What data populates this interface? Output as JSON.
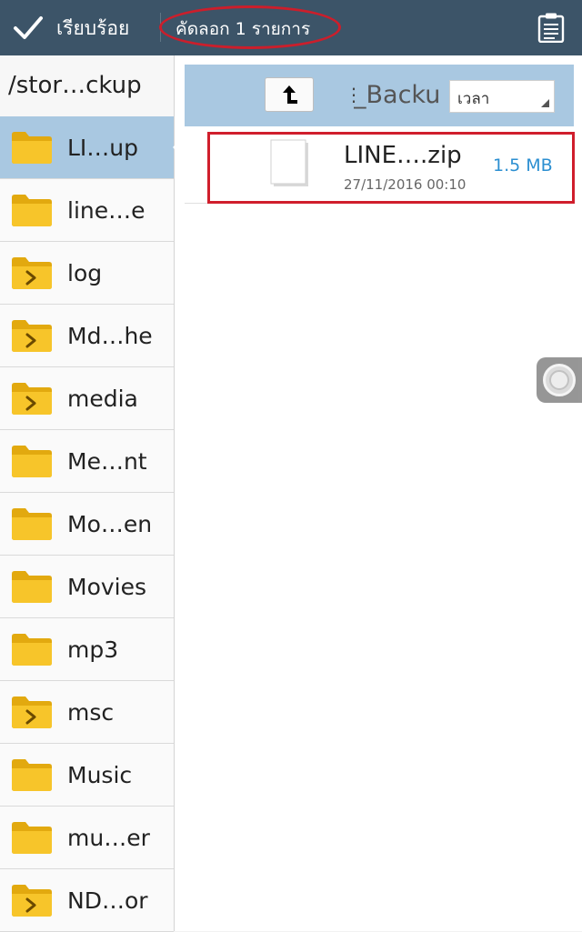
{
  "toolbar": {
    "done_label": "เรียบร้อย",
    "selection_count": "คัดลอก 1 รายการ"
  },
  "left_panel": {
    "current_path": "/stor…ckup",
    "folders": [
      {
        "label": "LI…up",
        "icon": "folder-icon",
        "selected": true
      },
      {
        "label": "line…e",
        "icon": "folder-icon"
      },
      {
        "label": "log",
        "icon": "folder-arrow-icon"
      },
      {
        "label": "Md…he",
        "icon": "folder-arrow-icon"
      },
      {
        "label": "media",
        "icon": "folder-arrow-icon"
      },
      {
        "label": "Me…nt",
        "icon": "folder-icon"
      },
      {
        "label": "Mo…en",
        "icon": "folder-icon"
      },
      {
        "label": "Movies",
        "icon": "folder-icon"
      },
      {
        "label": "mp3",
        "icon": "folder-icon"
      },
      {
        "label": "msc",
        "icon": "folder-arrow-icon"
      },
      {
        "label": "Music",
        "icon": "folder-icon"
      },
      {
        "label": "mu…er",
        "icon": "folder-icon"
      },
      {
        "label": "ND…or",
        "icon": "folder-arrow-icon"
      }
    ]
  },
  "right_panel": {
    "folder_name": "_Backup",
    "sort_label": "เวลา",
    "file": {
      "name": "LINE….zip",
      "date": "27/11/2016 00:10",
      "size": "1.5 MB"
    }
  },
  "colors": {
    "toolbar_bg": "#3c5468",
    "selection_blue": "#a9c8e1",
    "folder_yellow": "#f5c518",
    "size_blue": "#2c8fd1",
    "annotation_red": "#cc1e2b"
  }
}
